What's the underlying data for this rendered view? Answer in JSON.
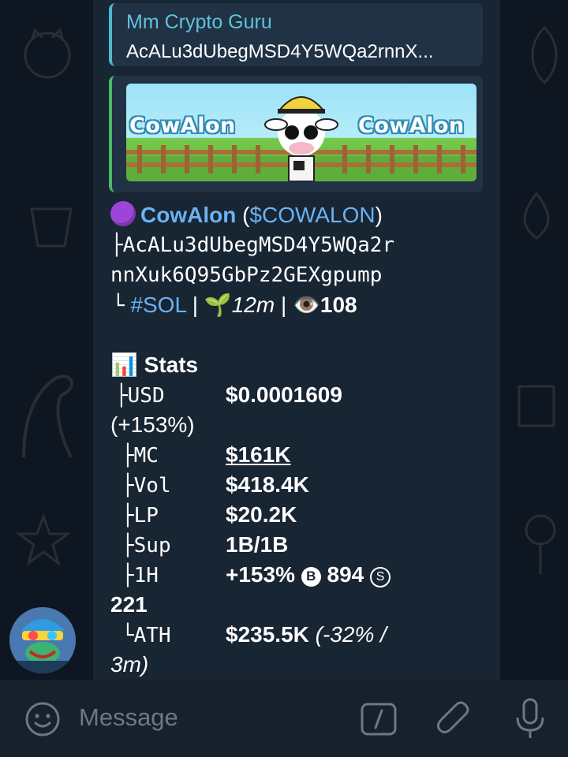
{
  "reply": {
    "author": "Mm Crypto Guru",
    "text": "AcALu3dUbegMSD4Y5WQa2rnnX..."
  },
  "preview": {
    "banner_left": "CowAlon",
    "banner_right": "CowAlon"
  },
  "token": {
    "name": "CowAlon",
    "symbol_open": " (",
    "symbol": "$COWALON",
    "symbol_close": ")",
    "address_line1": "├AcALu3dUbegMSD4Y5WQa2r",
    "address_line2": "nnXuk6Q95GbPz2GEXgpump",
    "corner": "└",
    "chain": "#SOL",
    "sep1": " | ",
    "age_icon": "🌱",
    "age": "12m",
    "sep2": " | ",
    "views_icon": "👁️",
    "views": "108"
  },
  "stats": {
    "icon": "📊",
    "title": "Stats",
    "rows": [
      {
        "prefix": "├USD",
        "value": "$0.0001609",
        "wrap": "(+153%)"
      },
      {
        "prefix": "├MC",
        "value": "$161K"
      },
      {
        "prefix": "├Vol",
        "value": "$418.4K"
      },
      {
        "prefix": "├LP",
        "value": "$20.2K"
      },
      {
        "prefix": "├Sup",
        "value": "1B/1B"
      },
      {
        "prefix": "├1H",
        "value": "+153%",
        "buys_icon": "B",
        "buys": "894",
        "sells_icon": "S",
        "sells_wrap": "221"
      },
      {
        "prefix": "└ATH",
        "value": "$235.5K",
        "extra": "(-32% /",
        "extra_wrap": "3m)"
      }
    ]
  },
  "composer": {
    "placeholder": "Message"
  },
  "colors": {
    "background": "#0e1621",
    "bubble": "#182533",
    "link": "#6ab2f2",
    "reply_accent": "#4fb8cf",
    "preview_accent": "#4ab866"
  },
  "icons": {
    "emoji": "emoji-icon",
    "command": "slash-command-icon",
    "attach": "paperclip-icon",
    "mic": "microphone-icon"
  }
}
